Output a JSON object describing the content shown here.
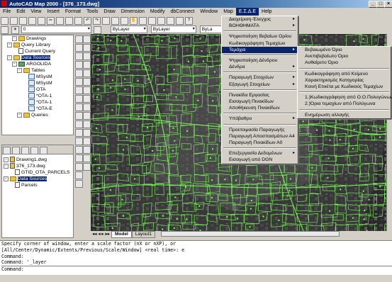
{
  "window": {
    "title": "AutoCAD Map 2000 - [376_173.dwg]",
    "controls": [
      "_",
      "□",
      "×"
    ]
  },
  "menubar": {
    "items": [
      "File",
      "Edit",
      "View",
      "Insert",
      "Format",
      "Tools",
      "Draw",
      "Dimension",
      "Modify",
      "dbConnect",
      "Window",
      "Map",
      "Ε.Σ.Δ.Ε",
      "Help"
    ],
    "active_index": 12
  },
  "toolbar": {
    "layer_value": "0",
    "color_value": "ByLayer",
    "linetype_value": "ByLayer",
    "lineweight_value": "ByLa"
  },
  "project_tree": {
    "items": [
      {
        "label": "Drawings",
        "icon": "folder-icon",
        "indent": 2
      },
      {
        "label": "Query Library",
        "icon": "folder-icon",
        "indent": 1
      },
      {
        "label": "Current Query",
        "icon": "doc-icon",
        "indent": 2
      },
      {
        "label": "Data Sources",
        "icon": "folder-icon",
        "indent": 1,
        "selected": true
      },
      {
        "label": "ARGOLIDA",
        "icon": "database-icon",
        "indent": 2
      },
      {
        "label": "Tables",
        "icon": "folder-icon",
        "indent": 3
      },
      {
        "label": "MSysM",
        "icon": "table-icon",
        "indent": 4
      },
      {
        "label": "MSysM",
        "icon": "table-icon",
        "indent": 4
      },
      {
        "label": "OTA",
        "icon": "table-icon",
        "indent": 4
      },
      {
        "label": "*OTA-1",
        "icon": "table-icon",
        "indent": 4
      },
      {
        "label": "*OTA-1",
        "icon": "table-icon",
        "indent": 4
      },
      {
        "label": "*OTA-E",
        "icon": "table-icon",
        "indent": 4
      },
      {
        "label": "Queries",
        "icon": "folder-icon",
        "indent": 3
      }
    ]
  },
  "drawing_tree": {
    "items": [
      {
        "label": "Drawing1.dwg",
        "icon": "dwg-icon",
        "indent": 0
      },
      {
        "label": "376_173.dwg",
        "icon": "dwg-icon",
        "indent": 0
      },
      {
        "label": "GTID_OTA_PARCELS",
        "icon": "link-icon",
        "indent": 1
      },
      {
        "label": "Data Sources",
        "icon": "folder-icon",
        "indent": 0,
        "selected": true
      },
      {
        "label": "Parcels",
        "icon": "link-icon",
        "indent": 1
      }
    ]
  },
  "layout_tabs": {
    "items": [
      "Model",
      "Layout1"
    ],
    "active_index": 0
  },
  "command_line": {
    "lines": [
      "Specify corner of window, enter a scale factor (nX or nXP), or",
      "[All/Center/Dynamic/Extents/Previous/Scale/Window] <real time>: e",
      "Command:",
      "Command: '_layer",
      "Command:"
    ]
  },
  "esdemenu": {
    "groups": [
      [
        {
          "label": "Διαχείριση-Έλεγχος",
          "submenu": true
        },
        {
          "label": "ΒΟΗΘΗΜΑΤΑ",
          "submenu": true
        }
      ],
      [
        {
          "label": "Ψηφιοποίηση Βεβαίων Ορίου"
        },
        {
          "label": "Κωδικογράφηση Τεμαχίων"
        },
        {
          "label": "Τεμάχια",
          "submenu": true,
          "highlighted": true
        }
      ],
      [
        {
          "label": "Ψηφιοποίηση Δένδρου"
        },
        {
          "label": "Δένδρα",
          "submenu": true
        }
      ],
      [
        {
          "label": "Παραγωγή Στοιχείων",
          "submenu": true
        },
        {
          "label": "Εξαγωγή Στοιχείων",
          "submenu": true
        }
      ],
      [
        {
          "label": "Πινακίδα Εργασίας"
        },
        {
          "label": "Εισαγωγή Πινακίδων"
        },
        {
          "label": "Αποθήκευση Πινακίδων"
        }
      ],
      [
        {
          "label": "Υπόβαθρο",
          "submenu": true
        }
      ],
      [
        {
          "label": "Προετοιμασία Παραγωγής"
        },
        {
          "label": "Παραγωγή Αποσπασμάτων Α4"
        },
        {
          "label": "Παραγωγή Πινακίδων Α0"
        }
      ],
      [
        {
          "label": "Επεξεργασία Δεδομένων",
          "submenu": true
        },
        {
          "label": "Εισαγωγή από DGN"
        }
      ]
    ]
  },
  "parcels_submenu": {
    "groups": [
      [
        {
          "label": "Βεβαιωμένο Όριο"
        },
        {
          "label": "Ανεπιβεβαίωτο Όριο"
        },
        {
          "label": "Αυθαίρετο Όριο"
        }
      ],
      [
        {
          "label": "Κωδικογράφηση από Κείμενο"
        },
        {
          "label": "Χαρακτηρισμός Κατηγορίας"
        },
        {
          "label": "Κοινή Ετικέτα με Κωδικούς Τεμαχίων"
        }
      ],
      [
        {
          "label": "1.)Κωδικογράφηση από Ο.Ο.Πολυγώνων"
        },
        {
          "label": "2.)Όρια τεμαχίων από Πολύγωνα"
        }
      ],
      [
        {
          "label": "Ενημέρωση αλλαγής"
        }
      ]
    ]
  },
  "colors": {
    "menu_highlight": "#0a246a",
    "drawing_background": "#1a1a1a",
    "parcel_lines": "#7CFC5A"
  }
}
